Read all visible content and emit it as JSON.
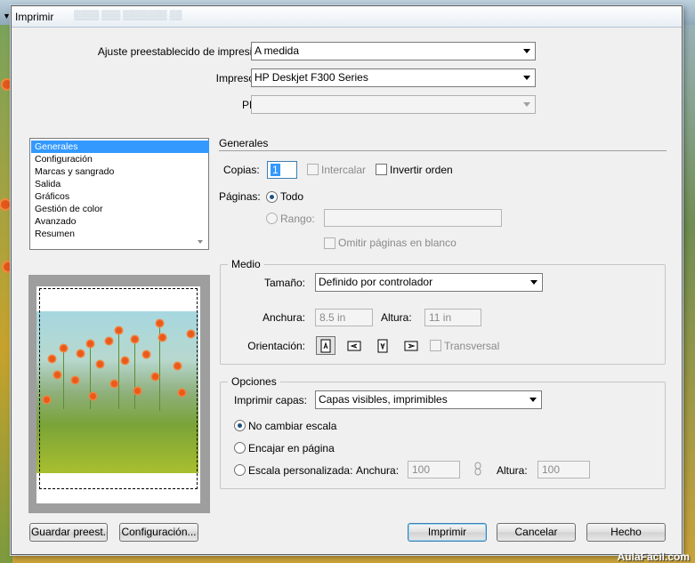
{
  "window": {
    "title": "Imprimir"
  },
  "preset": {
    "label": "Ajuste preestablecido de impresión:",
    "value": "A medida"
  },
  "printer": {
    "label": "Impresora:",
    "value": "HP Deskjet F300 Series"
  },
  "ppd": {
    "label": "PPD:",
    "value": ""
  },
  "sidebar": {
    "items": [
      {
        "label": "Generales",
        "selected": true
      },
      {
        "label": "Configuración"
      },
      {
        "label": "Marcas y sangrado"
      },
      {
        "label": "Salida"
      },
      {
        "label": "Gráficos"
      },
      {
        "label": "Gestión de color"
      },
      {
        "label": "Avanzado"
      },
      {
        "label": "Resumen"
      }
    ]
  },
  "general": {
    "heading": "Generales",
    "copies_label": "Copias:",
    "copies_value": "1",
    "collate_label": "Intercalar",
    "reverse_label": "Invertir orden",
    "pages_label": "Páginas:",
    "all_label": "Todo",
    "range_label": "Rango:",
    "range_value": "",
    "skip_blank_label": "Omitir páginas en blanco"
  },
  "media": {
    "heading": "Medio",
    "size_label": "Tamaño:",
    "size_value": "Definido por controlador",
    "width_label": "Anchura:",
    "width_value": "8.5 in",
    "height_label": "Altura:",
    "height_value": "11 in",
    "orientation_label": "Orientación:",
    "transverse_label": "Transversal",
    "orientation_icons": [
      "portrait-icon",
      "landscape-icon",
      "reverse-portrait-icon",
      "reverse-landscape-icon"
    ]
  },
  "options": {
    "heading": "Opciones",
    "layers_label": "Imprimir capas:",
    "layers_value": "Capas visibles, imprimibles",
    "no_scale_label": "No cambiar escala",
    "fit_label": "Encajar en página",
    "custom_label": "Escala personalizada:",
    "width_label": "Anchura:",
    "width_value": "100",
    "height_label": "Altura:",
    "height_value": "100"
  },
  "buttons": {
    "save_preset": "Guardar preest.",
    "setup": "Configuración...",
    "print": "Imprimir",
    "cancel": "Cancelar",
    "done": "Hecho"
  },
  "watermark": "AulaFacil.com",
  "colors": {
    "selection": "#3399ff",
    "dialog_bg": "#f0f0f0",
    "default_button_border": "#3c7fb1"
  }
}
